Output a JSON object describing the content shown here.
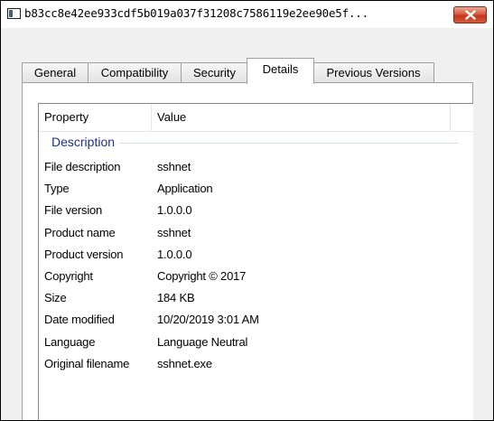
{
  "window": {
    "title": "b83cc8e42ee933cdf5b019a037f31208c7586119e2ee90e5f..."
  },
  "icons": {
    "window_icon": "window-icon",
    "close": "close-icon"
  },
  "tabs": [
    {
      "label": "General",
      "active": false
    },
    {
      "label": "Compatibility",
      "active": false
    },
    {
      "label": "Security",
      "active": false
    },
    {
      "label": "Details",
      "active": true
    },
    {
      "label": "Previous Versions",
      "active": false
    }
  ],
  "details": {
    "columns": {
      "property": "Property",
      "value": "Value"
    },
    "group": "Description",
    "rows": [
      {
        "property": "File description",
        "value": "sshnet"
      },
      {
        "property": "Type",
        "value": "Application"
      },
      {
        "property": "File version",
        "value": "1.0.0.0"
      },
      {
        "property": "Product name",
        "value": "sshnet"
      },
      {
        "property": "Product version",
        "value": "1.0.0.0"
      },
      {
        "property": "Copyright",
        "value": "Copyright © 2017"
      },
      {
        "property": "Size",
        "value": "184 KB"
      },
      {
        "property": "Date modified",
        "value": "10/20/2019 3:01 AM"
      },
      {
        "property": "Language",
        "value": "Language Neutral"
      },
      {
        "property": "Original filename",
        "value": "sshnet.exe"
      }
    ]
  },
  "colors": {
    "close_button": "#c43218",
    "group_label": "#1e3287",
    "dialog_background": "#f0f0f0"
  }
}
